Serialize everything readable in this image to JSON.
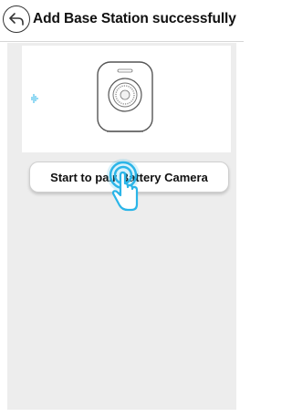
{
  "header": {
    "title": "Add Base Station successfully",
    "back_icon": "back-arrow-icon"
  },
  "illustration": {
    "icon": "battery-camera-icon",
    "signal_icon": "sound-wave-icon"
  },
  "actions": {
    "pair_label": "Start to pair Battery Camera"
  },
  "hint": {
    "icon": "tap-hand-icon",
    "color": "#2bb5e8"
  },
  "colors": {
    "accent": "#2bb5e8",
    "background": "#ededed",
    "surface": "#ffffff"
  }
}
